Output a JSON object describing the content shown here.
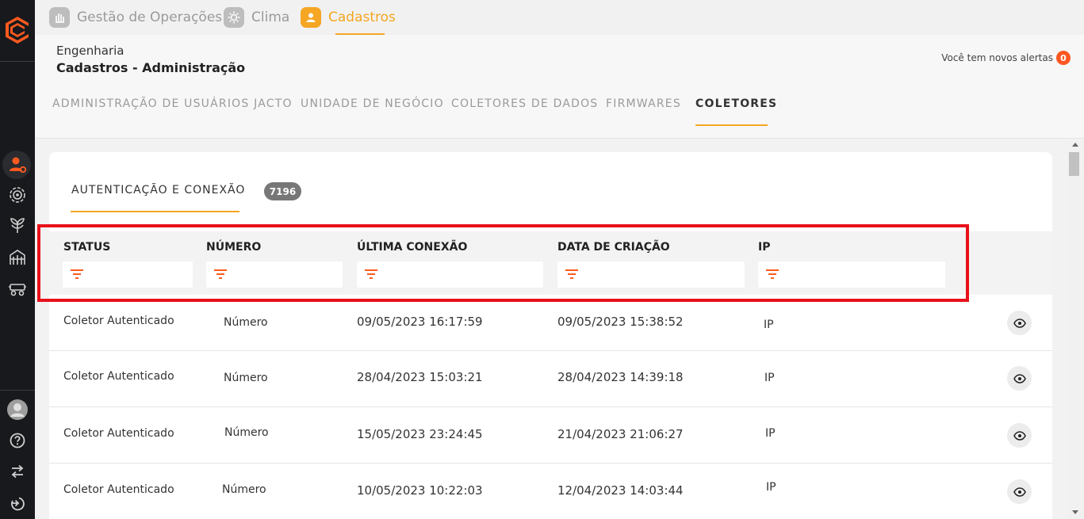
{
  "modules": [
    {
      "label": "Gestão de Operações",
      "icon": "hand-icon",
      "active": false
    },
    {
      "label": "Clima",
      "icon": "sun-icon",
      "active": false
    },
    {
      "label": "Cadastros",
      "icon": "user-icon",
      "active": true
    }
  ],
  "header": {
    "section": "Engenharia",
    "title": "Cadastros - Administração",
    "alerts_text": "Você tem novos alertas",
    "alerts_count": "0"
  },
  "tabs": [
    {
      "label": "ADMINISTRAÇÃO DE USUÁRIOS JACTO"
    },
    {
      "label": "UNIDADE DE NEGÓCIO"
    },
    {
      "label": "COLETORES DE DADOS"
    },
    {
      "label": "FIRMWARES"
    },
    {
      "label": "COLETORES",
      "active": true
    }
  ],
  "subtab": {
    "label": "AUTENTICAÇÃO E CONEXÃO",
    "count": "7196"
  },
  "table": {
    "columns": [
      "STATUS",
      "NÚMERO",
      "ÚLTIMA CONEXÃO",
      "DATA DE CRIAÇÃO",
      "IP"
    ],
    "rows": [
      {
        "status": "Coletor Autenticado",
        "numero": "Número",
        "ultima": "09/05/2023 16:17:59",
        "criacao": "09/05/2023 15:38:52",
        "ip": "IP"
      },
      {
        "status": "Coletor Autenticado",
        "numero": "Número",
        "ultima": "28/04/2023 15:03:21",
        "criacao": "28/04/2023 14:39:18",
        "ip": "IP"
      },
      {
        "status": "Coletor Autenticado",
        "numero": "Número",
        "ultima": "15/05/2023 23:24:45",
        "criacao": "21/04/2023 21:06:27",
        "ip": "IP"
      },
      {
        "status": "Coletor Autenticado",
        "numero": "Número",
        "ultima": "10/05/2023 10:22:03",
        "criacao": "12/04/2023 14:03:44",
        "ip": "IP"
      }
    ]
  },
  "colors": {
    "accent": "#f5a623",
    "rail": "#17191c",
    "highlight": "#e8101a",
    "badge": "#ff5722"
  },
  "icons": {
    "rail": [
      "logo-icon",
      "user-settings-icon",
      "target-icon",
      "plant-icon",
      "silo-icon",
      "tractor-icon",
      "avatar",
      "help-icon",
      "swap-icon",
      "logout-icon"
    ],
    "filter": "filter-icon",
    "view": "eye-icon"
  }
}
